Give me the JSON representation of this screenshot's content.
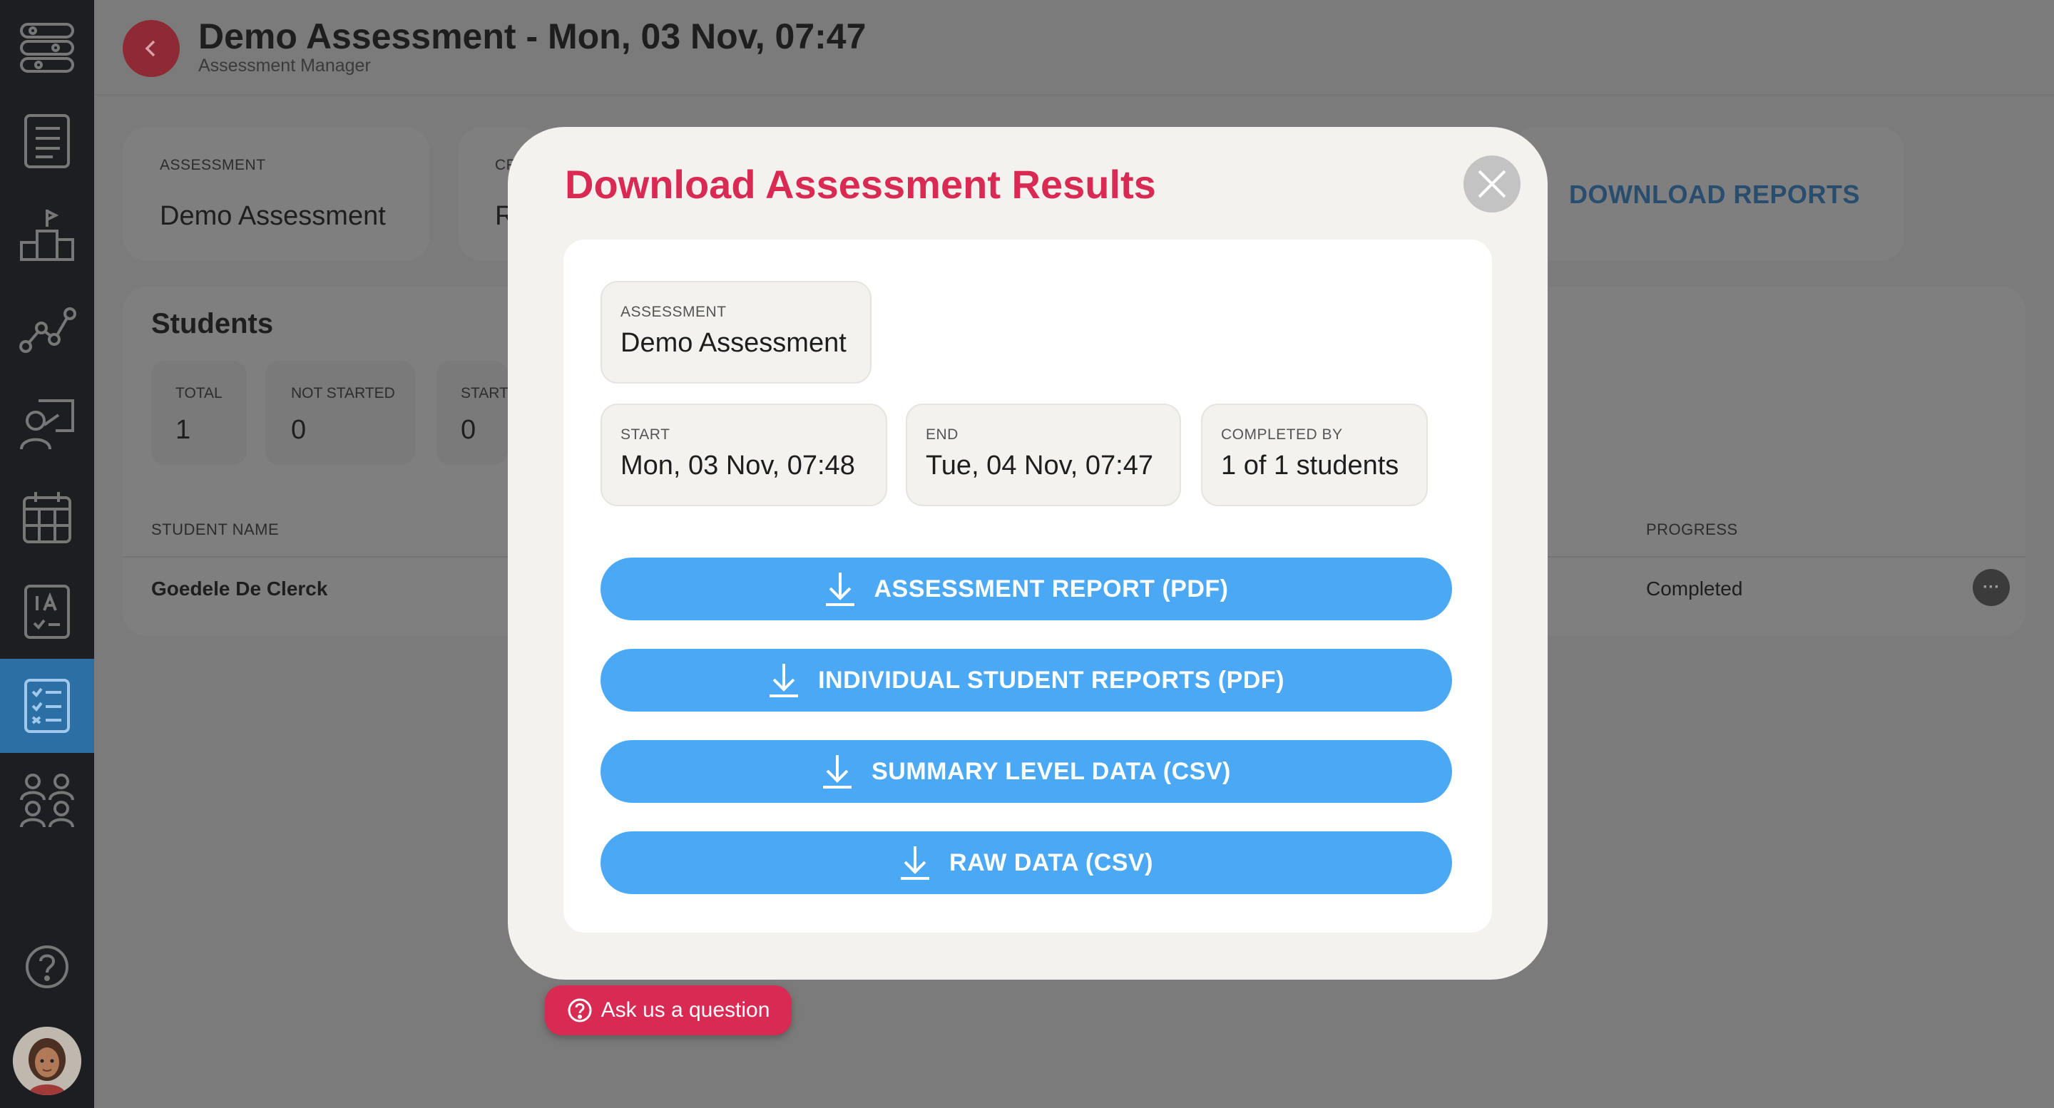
{
  "header": {
    "title": "Demo Assessment - Mon, 03 Nov, 07:47",
    "subtitle": "Assessment Manager"
  },
  "summary_cards": {
    "assessment_label": "ASSESSMENT",
    "assessment_value": "Demo Assessment",
    "second_label_partial": "CR",
    "second_value_partial": "R",
    "download_reports": "DOWNLOAD REPORTS"
  },
  "students": {
    "title": "Students",
    "stats": [
      {
        "label": "TOTAL",
        "value": "1"
      },
      {
        "label": "NOT STARTED",
        "value": "0"
      },
      {
        "label": "START",
        "value": "0"
      }
    ],
    "columns": {
      "name": "STUDENT NAME",
      "progress": "PROGRESS"
    },
    "rows": [
      {
        "name": "Goedele De Clerck",
        "progress": "Completed"
      }
    ]
  },
  "modal": {
    "title": "Download Assessment Results",
    "assessment": {
      "label": "ASSESSMENT",
      "value": "Demo Assessment"
    },
    "start": {
      "label": "START",
      "value": "Mon, 03 Nov, 07:48"
    },
    "end": {
      "label": "END",
      "value": "Tue, 04 Nov, 07:47"
    },
    "completed_by": {
      "label": "COMPLETED BY",
      "value": "1 of 1 students"
    },
    "buttons": [
      {
        "label": "ASSESSMENT REPORT (PDF)",
        "icon": "download-icon"
      },
      {
        "label": "INDIVIDUAL STUDENT REPORTS (PDF)",
        "icon": "download-icon"
      },
      {
        "label": "SUMMARY LEVEL DATA (CSV)",
        "icon": "download-icon"
      },
      {
        "label": "RAW DATA (CSV)",
        "icon": "download-icon"
      }
    ]
  },
  "help": {
    "label": "Ask us a question",
    "icon": "question-circle-icon"
  },
  "sidebar": {
    "items": [
      {
        "icon": "pathways-icon"
      },
      {
        "icon": "list-icon"
      },
      {
        "icon": "podium-icon"
      },
      {
        "icon": "trend-icon"
      },
      {
        "icon": "teacher-icon"
      },
      {
        "icon": "calendar-icon"
      },
      {
        "icon": "ia-checklist-icon"
      },
      {
        "icon": "assessment-checklist-icon",
        "active": true
      },
      {
        "icon": "group-icon"
      },
      {
        "icon": "help-icon"
      }
    ]
  },
  "colors": {
    "accent_red": "#d82a52",
    "button_blue": "#4aa8f5",
    "sidebar_bg": "#1c1e22",
    "sidebar_active": "#2c6fa5"
  }
}
